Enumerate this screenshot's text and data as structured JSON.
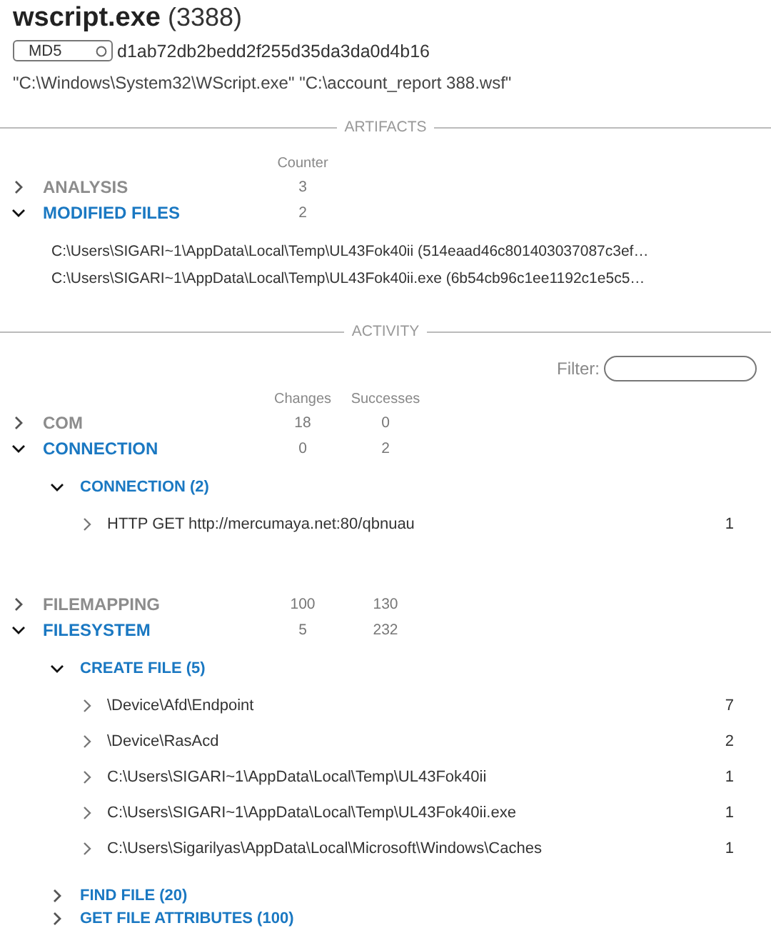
{
  "process": {
    "name": "wscript.exe",
    "pid": "(3388)"
  },
  "hash": {
    "type": "MD5",
    "value": "d1ab72db2bedd2f255d35da3da0d4b16"
  },
  "command_line": "\"C:\\Windows\\System32\\WScript.exe\" \"C:\\account_report 388.wsf\"",
  "artifacts": {
    "title": "ARTIFACTS",
    "columns": [
      "Counter"
    ],
    "categories": [
      {
        "label": "ANALYSIS",
        "expanded": false,
        "values": [
          "3"
        ]
      },
      {
        "label": "MODIFIED FILES",
        "expanded": true,
        "values": [
          "2"
        ],
        "files": [
          "C:\\Users\\SIGARI~1\\AppData\\Local\\Temp\\UL43Fok40ii (514eaad46c801403037087c3ef…",
          "C:\\Users\\SIGARI~1\\AppData\\Local\\Temp\\UL43Fok40ii.exe (6b54cb96c1ee1192c1e5c5…"
        ]
      }
    ]
  },
  "activity": {
    "title": "ACTIVITY",
    "filter": {
      "label": "Filter:"
    },
    "columns": [
      "Changes",
      "Successes"
    ],
    "categories": [
      {
        "label": "COM",
        "expanded": false,
        "values": [
          "18",
          "0"
        ]
      },
      {
        "label": "CONNECTION",
        "expanded": true,
        "values": [
          "0",
          "2"
        ],
        "children": [
          {
            "label": "CONNECTION (2)",
            "expanded": true,
            "children": [
              {
                "label": "HTTP GET http://mercumaya.net:80/qbnuau",
                "count": "1",
                "expanded": false
              }
            ]
          }
        ]
      },
      {
        "label": "FILEMAPPING",
        "expanded": false,
        "values": [
          "100",
          "130"
        ]
      },
      {
        "label": "FILESYSTEM",
        "expanded": true,
        "values": [
          "5",
          "232"
        ],
        "children": [
          {
            "label": "CREATE FILE (5)",
            "expanded": true,
            "children": [
              {
                "label": "\\Device\\Afd\\Endpoint",
                "count": "7",
                "expanded": false
              },
              {
                "label": "\\Device\\RasAcd",
                "count": "2",
                "expanded": false
              },
              {
                "label": "C:\\Users\\SIGARI~1\\AppData\\Local\\Temp\\UL43Fok40ii",
                "count": "1",
                "expanded": false
              },
              {
                "label": "C:\\Users\\SIGARI~1\\AppData\\Local\\Temp\\UL43Fok40ii.exe",
                "count": "1",
                "expanded": false
              },
              {
                "label": "C:\\Users\\Sigarilyas\\AppData\\Local\\Microsoft\\Windows\\Caches",
                "count": "1",
                "expanded": false
              }
            ]
          },
          {
            "label": "FIND FILE (20)",
            "expanded": false
          },
          {
            "label": "GET FILE ATTRIBUTES (100)",
            "expanded": false
          }
        ]
      }
    ]
  }
}
